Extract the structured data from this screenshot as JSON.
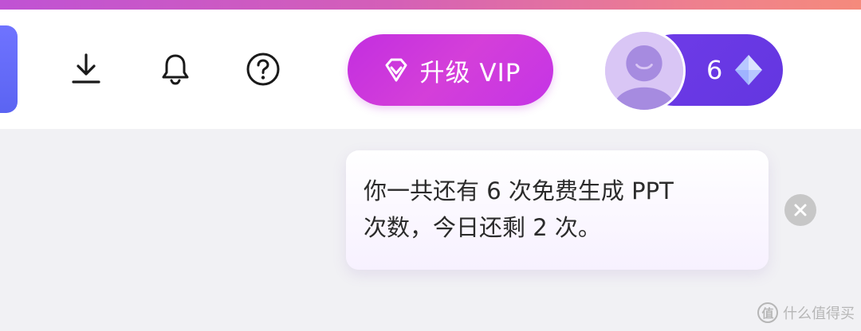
{
  "header": {
    "vip_button_label": "升级 VIP",
    "credits_count": "6",
    "icons": [
      "download-icon",
      "bell-icon",
      "help-icon",
      "diamond-icon",
      "avatar-icon"
    ]
  },
  "tooltip": {
    "message": "你一共还有 6 次免费生成 PPT\n次数，今日还剩 2 次。"
  },
  "watermark": {
    "text": "什么值得买",
    "badge": "值"
  },
  "colors": {
    "vip_gradient_start": "#c32ee0",
    "user_pill": "#6f3be8",
    "avatar_bg": "#d9c6f5",
    "page_bg": "#f1f1f4",
    "close_button": "#c7c7c7"
  }
}
